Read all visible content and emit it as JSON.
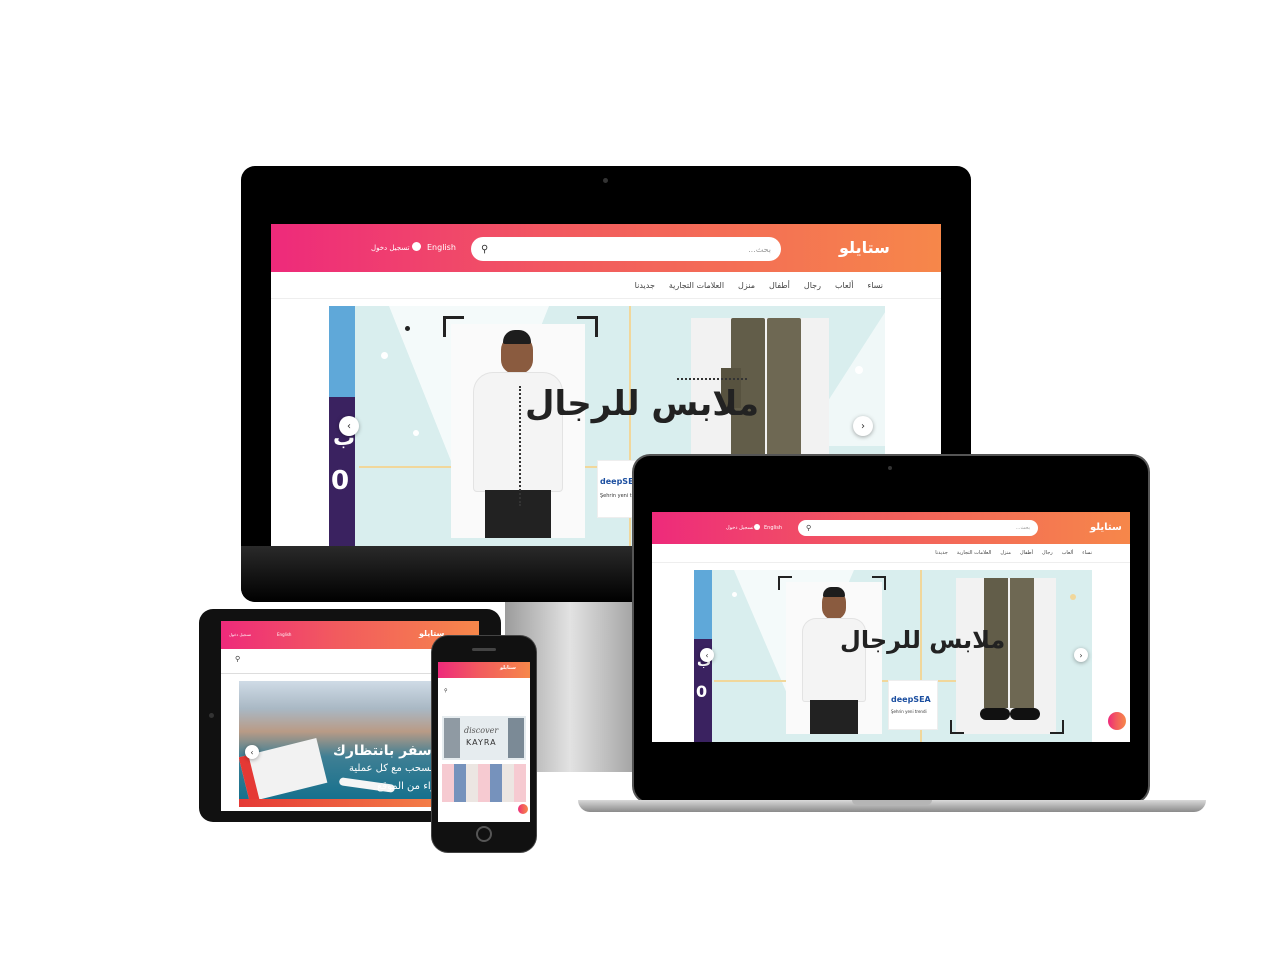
{
  "site": {
    "logo_text": "ستايلو",
    "search_placeholder": "بحث...",
    "language": "English",
    "login": "تسجيل دخول",
    "nav": [
      "نساء",
      "ألعاب",
      "رجال",
      "أطفال",
      "منزل",
      "العلامات التجارية",
      "جديدنا"
    ],
    "banner_headline": "ملابس للرجال",
    "brand_badge": "deepSEA",
    "brand_sub": "Şehrin yeni trendi",
    "side_text": "ب",
    "side_number": "0",
    "tablet_banner": [
      "تذكرتي سفر بانتظارك",
      "ادخل السحب مع كل عملية",
      "شراء من الموقع"
    ],
    "phone_banner": [
      "discover",
      "KAYRA"
    ]
  },
  "colors": {
    "gradient_start": "#ee2a7b",
    "gradient_end": "#f6874a",
    "banner_bg": "#d9eeee",
    "accent_purple": "#3a2260"
  }
}
